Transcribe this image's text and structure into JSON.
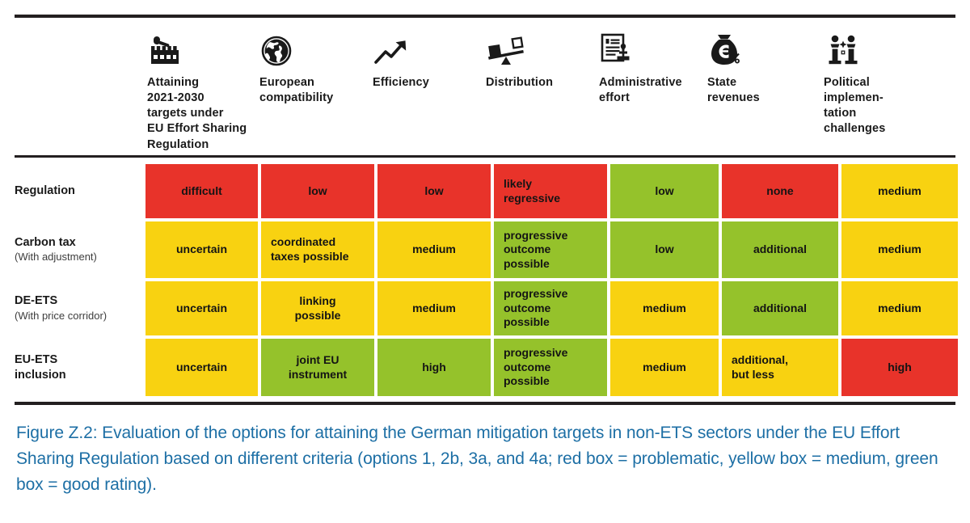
{
  "figure": {
    "caption": "Figure Z.2: Evaluation of the options for attaining the German mitigation targets in non-ETS sectors under the EU Effort Sharing Regulation based on different criteria (options 1, 2b, 3a, and 4a; red box = problematic, yellow box = medium, green box = good rating).",
    "caption_color": "#1d6fa5"
  },
  "legend": {
    "red": "red box = problematic",
    "yellow": "yellow box = medium",
    "green": "green box = good rating"
  },
  "colors": {
    "red": "#e8332a",
    "yellow": "#f8d211",
    "green": "#95c22b",
    "rule": "#231f20",
    "text": "#1a1a1a"
  },
  "table": {
    "columns": [
      {
        "label": "Attaining\n2021-2030\ntargets under\nEU Effort Sharing\nRegulation",
        "icon": "factory-icon"
      },
      {
        "label": "European\ncompatibility",
        "icon": "globe-icon"
      },
      {
        "label": "Efficiency",
        "icon": "trending-up-arrow-icon"
      },
      {
        "label": "Distribution",
        "icon": "balance-scales-icon"
      },
      {
        "label": "Administrative\neffort",
        "icon": "document-stamp-icon"
      },
      {
        "label": "State\nrevenues",
        "icon": "money-bag-percent-icon"
      },
      {
        "label": "Political\nimplemen-\ntation\nchallenges",
        "icon": "two-people-icon"
      }
    ],
    "rows": [
      {
        "label": "Regulation",
        "sublabel": "",
        "cells": [
          {
            "text": "difficult",
            "rating": "red",
            "align": "center"
          },
          {
            "text": "low",
            "rating": "red",
            "align": "center"
          },
          {
            "text": "low",
            "rating": "red",
            "align": "center"
          },
          {
            "text": "likely\nregressive",
            "rating": "red",
            "align": "left"
          },
          {
            "text": "low",
            "rating": "green",
            "align": "center"
          },
          {
            "text": "none",
            "rating": "red",
            "align": "center"
          },
          {
            "text": "medium",
            "rating": "yellow",
            "align": "center"
          }
        ]
      },
      {
        "label": "Carbon tax",
        "sublabel": "(With adjustment)",
        "cells": [
          {
            "text": "uncertain",
            "rating": "yellow",
            "align": "center"
          },
          {
            "text": "coordinated\ntaxes possible",
            "rating": "yellow",
            "align": "left"
          },
          {
            "text": "medium",
            "rating": "yellow",
            "align": "center"
          },
          {
            "text": "progressive\noutcome\npossible",
            "rating": "green",
            "align": "left"
          },
          {
            "text": "low",
            "rating": "green",
            "align": "center"
          },
          {
            "text": "additional",
            "rating": "green",
            "align": "center"
          },
          {
            "text": "medium",
            "rating": "yellow",
            "align": "center"
          }
        ]
      },
      {
        "label": "DE-ETS",
        "sublabel": "(With price corridor)",
        "cells": [
          {
            "text": "uncertain",
            "rating": "yellow",
            "align": "center"
          },
          {
            "text": "linking\npossible",
            "rating": "yellow",
            "align": "center"
          },
          {
            "text": "medium",
            "rating": "yellow",
            "align": "center"
          },
          {
            "text": "progressive\noutcome\npossible",
            "rating": "green",
            "align": "left"
          },
          {
            "text": "medium",
            "rating": "yellow",
            "align": "center"
          },
          {
            "text": "additional",
            "rating": "green",
            "align": "center"
          },
          {
            "text": "medium",
            "rating": "yellow",
            "align": "center"
          }
        ]
      },
      {
        "label": "EU-ETS\ninclusion",
        "sublabel": "",
        "cells": [
          {
            "text": "uncertain",
            "rating": "yellow",
            "align": "center"
          },
          {
            "text": "joint EU\ninstrument",
            "rating": "green",
            "align": "center"
          },
          {
            "text": "high",
            "rating": "green",
            "align": "center"
          },
          {
            "text": "progressive\noutcome\npossible",
            "rating": "green",
            "align": "left"
          },
          {
            "text": "medium",
            "rating": "yellow",
            "align": "center"
          },
          {
            "text": "additional,\nbut less",
            "rating": "yellow",
            "align": "left"
          },
          {
            "text": "high",
            "rating": "red",
            "align": "center"
          }
        ]
      }
    ]
  }
}
